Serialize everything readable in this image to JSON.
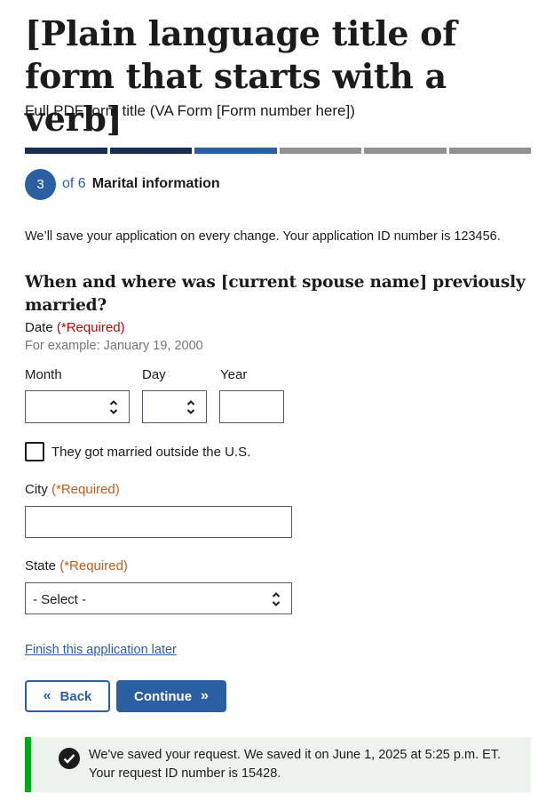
{
  "header": {
    "title": "[Plain language title of form that starts with a verb]",
    "subtitle": "Full PDF form title (VA Form [Form number here])"
  },
  "progress": {
    "segments_total": 6,
    "segments_complete": 3,
    "colors": {
      "complete": "#162e51",
      "current": "#2a5fa3",
      "incomplete": "#919191"
    }
  },
  "step": {
    "number": "3",
    "of_text": "of 6",
    "name": "Marital information"
  },
  "save_note": "We’ll save your application on every change. Your application ID number is 123456.",
  "question": "When and where was [current spouse name] previously married?",
  "date": {
    "label": "Date",
    "required": "(*Required)",
    "hint": "For example: January 19, 2000",
    "month_label": "Month",
    "day_label": "Day",
    "year_label": "Year",
    "month_value": "",
    "day_value": "",
    "year_value": ""
  },
  "outside_us": {
    "label": "They got married outside the U.S.",
    "checked": false
  },
  "city": {
    "label": "City",
    "required": "(*Required)",
    "value": ""
  },
  "state": {
    "label": "State",
    "required": "(*Required)",
    "value": "- Select -"
  },
  "finish_later_link": "Finish this application later",
  "buttons": {
    "back": "Back",
    "back_icon": "«",
    "continue": "Continue",
    "continue_icon": "»"
  },
  "alert": {
    "line1": "We've saved your request. We saved it on June 1, 2025 at 5:25 p.m. ET.",
    "line2": "Your request ID number is 15428.",
    "icon": "check-circle-icon"
  }
}
